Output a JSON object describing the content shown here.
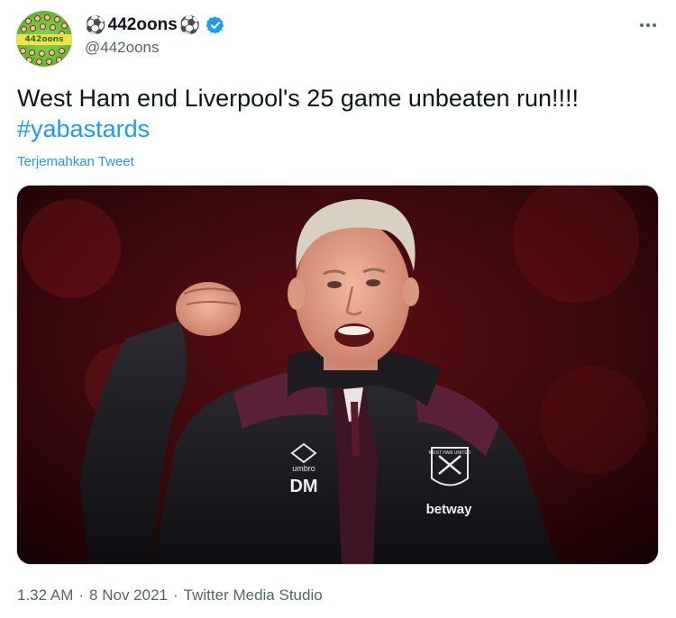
{
  "author": {
    "display_name": "442oons",
    "name_emoji": "⚽",
    "handle": "@442oons",
    "verified": true
  },
  "tweet": {
    "text": "West Ham end Liverpool's 25 game unbeaten run!!!!",
    "hashtag": "#yabastards",
    "translate_label": "Terjemahkan Tweet"
  },
  "media": {
    "jacket_text": "DM",
    "brand_text": "umbro",
    "sponsor_text": "betway",
    "badge_text": "WEST HAM UNITED"
  },
  "meta": {
    "time": "1.32 AM",
    "separator": "·",
    "date": "8 Nov 2021",
    "source": "Twitter Media Studio"
  },
  "colors": {
    "accent": "#1d9bf0",
    "secondary_text": "#536471"
  },
  "icons": {
    "more": "more-icon",
    "verified": "verified-badge-icon"
  }
}
